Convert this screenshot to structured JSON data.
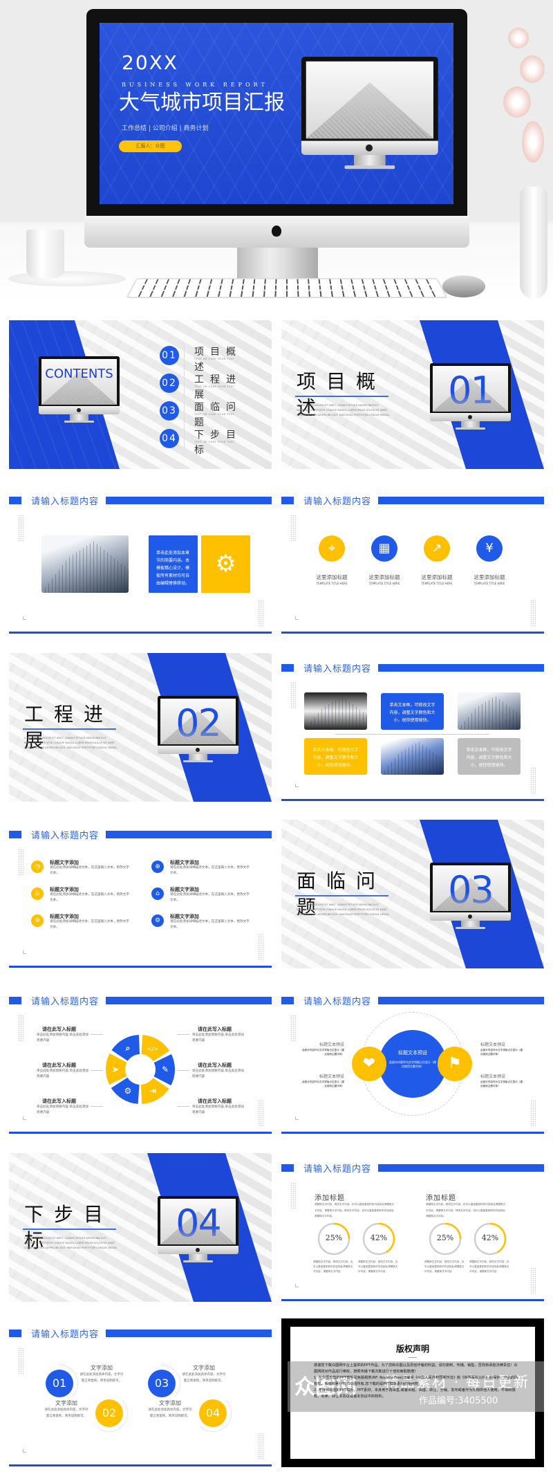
{
  "colors": {
    "blue": "#1f5ae8",
    "yellow": "#ffc000",
    "gray": "#bdbdbd"
  },
  "hero": {
    "year": "20XX",
    "subtitle_en": "BUSINESS WORK REPORT",
    "title": "大气城市项目汇报",
    "tagline": "工作总结 | 公司介绍 | 商务计划",
    "reporter": "汇报人：众图"
  },
  "contents": {
    "label": "CONTENTS",
    "items": [
      {
        "num": "01",
        "title": "项目概述",
        "sub": "TEXT OR CASE YOUR TEXT"
      },
      {
        "num": "02",
        "title": "工程进展",
        "sub": "TEXT OR CASE YOUR TEXT"
      },
      {
        "num": "03",
        "title": "面临问题",
        "sub": "TEXT OR CASE YOUR TEXT"
      },
      {
        "num": "04",
        "title": "下步目标",
        "sub": "TEXT OR CASE YOUR TEXT"
      }
    ]
  },
  "sections": [
    {
      "num": "01",
      "title": "项目概述",
      "lorem": "LOREM IPSUM DOLOR SIT AMET, CONSECTETUER ADIPISCING ELIT. MAECENAS PORTTITOR CONGUE MASSA. LOREM IPSUM DOLOR SIT AMET, CONSECTETUER ADIPISCING ELIT. MAECENAS PORTTITOR CONGUE MASSA."
    },
    {
      "num": "02",
      "title": "工程进展",
      "lorem": "LOREM IPSUM DOLOR SIT AMET, CONSECTETUER ADIPISCING ELIT. MAECENAS PORTTITOR CONGUE MASSA. LOREM IPSUM DOLOR SIT AMET, CONSECTETUER ADIPISCING ELIT. MAECENAS PORTTITOR CONGUE MASSA."
    },
    {
      "num": "03",
      "title": "面临问题",
      "lorem": "LOREM IPSUM DOLOR SIT AMET, CONSECTETUER ADIPISCING ELIT. MAECENAS PORTTITOR CONGUE MASSA. LOREM IPSUM DOLOR SIT AMET, CONSECTETUER ADIPISCING ELIT. MAECENAS PORTTITOR CONGUE MASSA."
    },
    {
      "num": "04",
      "title": "下步目标",
      "lorem": "LOREM IPSUM DOLOR SIT AMET, CONSECTETUER ADIPISCING ELIT. MAECENAS PORTTITOR CONGUE MASSA. LOREM IPSUM DOLOR SIT AMET, CONSECTETUER ADIPISCING ELIT. MAECENAS PORTTITOR CONGUE MASSA."
    }
  ],
  "slide_header": "请输入标题内容",
  "intro_slide": {
    "text": "单击此处添加本章节的简要内容。本模板精心设计，模板所有素材均可自由编辑替换移动。",
    "icon": "gears-icon"
  },
  "icons_slide": {
    "items": [
      {
        "icon": "location-pin-icon",
        "glyph": "⌖",
        "color": "yellow",
        "title": "这里添加标题",
        "sub": "TEMPLATE TITLE HERE"
      },
      {
        "icon": "presentation-chart-icon",
        "glyph": "▦",
        "color": "blue",
        "title": "这里添加标题",
        "sub": "TEMPLATE TITLE HERE"
      },
      {
        "icon": "growth-chart-icon",
        "glyph": "↗",
        "color": "yellow",
        "title": "这里添加标题",
        "sub": "TEMPLATE TITLE HERE"
      },
      {
        "icon": "money-hands-icon",
        "glyph": "¥",
        "color": "blue",
        "title": "这里添加标题",
        "sub": "TEMPLATE TITLE HERE"
      }
    ]
  },
  "grid_slide": {
    "box_text": "单击文本框，可修改文字内容，调整文字颜色和大小，祝你使用愉快。"
  },
  "list_slide": {
    "items": [
      {
        "icon": "clock-icon",
        "glyph": "◷",
        "color": "yellow",
        "title": "标题文字添加",
        "desc": "请在此处添加详细描述文本，在这里输入文本，更改文字文本。"
      },
      {
        "icon": "globe-icon",
        "glyph": "⊕",
        "color": "blue",
        "title": "标题文字添加",
        "desc": "请在此处添加详细描述文本，在这里输入文本，更改文字文本。"
      },
      {
        "icon": "building-icon",
        "glyph": "⌂",
        "color": "yellow",
        "title": "标题文字添加",
        "desc": "请在此处添加详细描述文本，在这里输入文本，更改文字文本。"
      },
      {
        "icon": "home-icon",
        "glyph": "⌂",
        "color": "blue",
        "title": "标题文字添加",
        "desc": "请在此处添加详细描述文本，在这里输入文本，更改文字文本。"
      },
      {
        "icon": "gear-icon",
        "glyph": "⚙",
        "color": "yellow",
        "title": "标题文字添加",
        "desc": "请在此处添加详细描述文本，在这里输入文本，更改文字文本。"
      },
      {
        "icon": "settings-icon",
        "glyph": "⚙",
        "color": "blue",
        "title": "标题文字添加",
        "desc": "请在此处添加详细描述文本，在这里输入文本，更改文字文本。"
      }
    ]
  },
  "ring_slide": {
    "labels": [
      {
        "title": "请在此写入标题",
        "desc": "单击此处添加简要内容,单击此处添加简要内容"
      },
      {
        "title": "请在此写入标题",
        "desc": "单击此处添加简要内容,单击此处添加简要内容"
      },
      {
        "title": "请在此写入标题",
        "desc": "单击此处添加简要内容,单击此处添加简要内容"
      },
      {
        "title": "请在此写入标题",
        "desc": "单击此处添加简要内容,单击此处添加简要内容"
      },
      {
        "title": "请在此写入标题",
        "desc": "单击此处添加简要内容,单击此处添加简要内容"
      },
      {
        "title": "请在此写入标题",
        "desc": "单击此处添加简要内容,单击此处添加简要内容"
      }
    ],
    "segments": [
      {
        "icon": "search-icon",
        "glyph": "⌕",
        "color": "blue"
      },
      {
        "icon": "code-icon",
        "glyph": "</>",
        "color": "yellow"
      },
      {
        "icon": "edit-icon",
        "glyph": "✎",
        "color": "blue"
      },
      {
        "icon": "exit-icon",
        "glyph": "⇥",
        "color": "yellow"
      },
      {
        "icon": "gears-icon",
        "glyph": "⚙",
        "color": "blue"
      },
      {
        "icon": "send-icon",
        "glyph": "➤",
        "color": "yellow"
      }
    ]
  },
  "circle_slide": {
    "center_title": "标题文本预设",
    "center_desc": "此部分内容作为文字排版占位显示（建议使用主题字体）",
    "left_icon": "handshake-icon",
    "right_icon": "signpost-icon",
    "labels": [
      {
        "title": "标题文本预设",
        "desc": "此部分内容作为文字排版占位显示（建议使用主题字体）"
      },
      {
        "title": "标题文本预设",
        "desc": "此部分内容作为文字排版占位显示（建议使用主题字体）"
      },
      {
        "title": "标题文本预设",
        "desc": "此部分内容作为文字排版占位显示（建议使用主题字体）"
      },
      {
        "title": "标题文本预设",
        "desc": "此部分内容作为文字排版占位显示（建议使用主题字体）"
      }
    ]
  },
  "percent_slide": {
    "columns": [
      {
        "title": "添加标题",
        "desc": "请替换文字内容，修改文字内容，也可以直接复制你的内容到此请替换文字内容，请替换文字内容，修改文字内容，也可以直接复制你的内容到此请替换文字内容。",
        "rings": [
          {
            "value": 25,
            "label": "25%",
            "desc": "请替换文字内容，修改文字内容，也可以直接复制你的内容到此请替换文字内容，请替换文字内容"
          },
          {
            "value": 42,
            "label": "42%",
            "desc": "请替换文字内容，修改文字内容，也可以直接复制你的内容到此请替换文字内容，请替换文字内容"
          }
        ]
      },
      {
        "title": "添加标题",
        "desc": "请替换文字内容，修改文字内容，也可以直接复制你的内容到此请替换文字内容，请替换文字内容，修改文字内容，也可以直接复制你的内容到此请替换文字内容。",
        "rings": [
          {
            "value": 25,
            "label": "25%",
            "desc": "请替换文字内容，修改文字内容，也可以直接复制你的内容到此请替换文字内容，请替换文字内容"
          },
          {
            "value": 42,
            "label": "42%",
            "desc": "请替换文字内容，修改文字内容，也可以直接复制你的内容到此请替换文字内容，请替换文字内容"
          }
        ]
      }
    ]
  },
  "steps_slide": {
    "items": [
      {
        "num": "01",
        "color": "blue",
        "title": "文字添加",
        "desc": "请在此处添加具体内容，文字尽量言简意赅，简单说明即可。"
      },
      {
        "num": "02",
        "color": "yellow",
        "title": "文字添加",
        "desc": "请在此处添加具体内容，文字尽量言简意赅，简单说明即可。"
      },
      {
        "num": "03",
        "color": "blue",
        "title": "文字添加",
        "desc": "请在此处添加具体内容，文字尽量言简意赅，简单说明即可。"
      },
      {
        "num": "04",
        "color": "yellow",
        "title": "文字添加",
        "desc": "请在此处添加具体内容，文字尽量言简意赅，简单说明即可。"
      }
    ]
  },
  "copyright": {
    "title": "版权声明",
    "paragraphs": [
      "感谢您下载众图网平台上提供的PPT作品，为了您和众图以及原创作者的利益，请勿复制、传播、销售，否则将承担法律责任！众图网将对作品进行维权，按照传播下载次数进行十倍的索取赔偿！",
      "1. 在众图出售的PPT模板是免版税类(RF: Royalty-Free)正版受《中国人民共和国著作法》和《世界版权公约》的保护，作品的所有权、版权和著作权归众图所有,您下载的是PPT模板素材的使用权。",
      "2. 不得将众图的PPT模板、PPT素材，本身用于再出售,或者出租、出借、转让、分销、发布或者作为礼物供他人使用，不得转授权、出卖、转让本协议或者本协议中的权利。"
    ]
  },
  "watermark": {
    "logo": "众图网",
    "slogan": "精品素材 · 每日更新",
    "id": "作品编号:3405500"
  }
}
